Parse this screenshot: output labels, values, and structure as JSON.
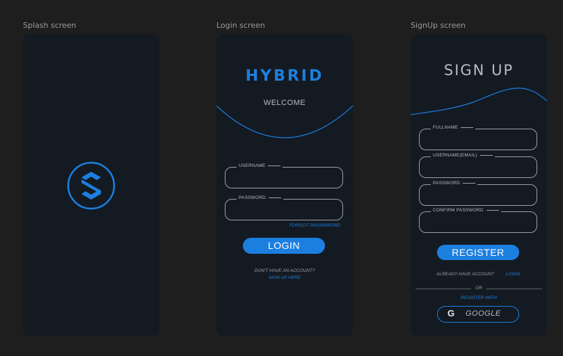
{
  "frames": {
    "splash": {
      "label": "Splash screen"
    },
    "login": {
      "label": "Login screen",
      "title": "HYBRID",
      "welcome": "WELCOME",
      "username_label": "USERNAME",
      "password_label": "PASSWORD",
      "forgot": "FORGOT PASSWWORD",
      "login_button": "LOGIN",
      "no_account": "DON'T HAVE AN ACCOUNT?",
      "signup_link": "SIGN UP HERE"
    },
    "signup": {
      "label": "SignUp screen",
      "title": "SIGN UP",
      "fullname_label": "FULLNAME",
      "email_label": "USERNAME(EMAIL)",
      "password_label": "PASSWORD",
      "confirm_label": "CONFIRM PASSWORD",
      "register_button": "REGISTER",
      "already": "ALREADY HAVE ACCOUNT",
      "login_link": "LOGIN",
      "or": "OR",
      "register_with": "REGISTER WITH",
      "google_glyph": "G",
      "google_button": "GOOGLE"
    }
  },
  "colors": {
    "background": "#1e1e1e",
    "screen": "#141a21",
    "accent": "#1c7fe0",
    "muted_text": "#b8bcc2",
    "field_border": "#9aa0a8"
  }
}
